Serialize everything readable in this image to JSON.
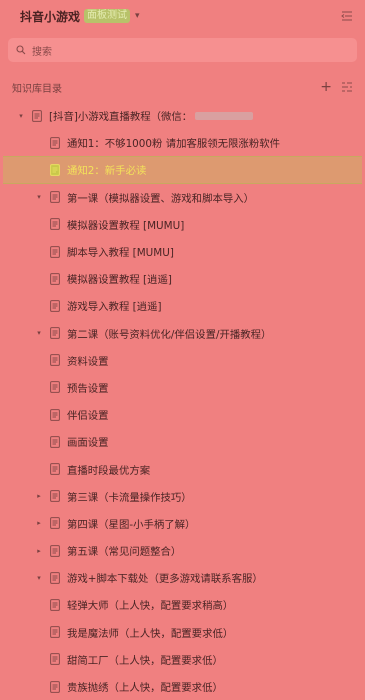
{
  "header": {
    "title": "抖音小游戏",
    "badge": "面板测试",
    "caret": "▾"
  },
  "search": {
    "placeholder": "搜索"
  },
  "section": {
    "title": "知识库目录",
    "add": "+"
  },
  "tree": [
    {
      "label": "[抖音]小游戏直播教程（微信：",
      "level": 0,
      "arrow": "▾",
      "blurred": true
    },
    {
      "label": "通知1：不够1000粉 请加客服领无限涨粉软件",
      "level": 1,
      "arrow": ""
    },
    {
      "label": "通知2：新手必读",
      "level": 1,
      "arrow": "",
      "selected": true
    },
    {
      "label": "第一课（模拟器设置、游戏和脚本导入）",
      "level": 1,
      "arrow": "▾"
    },
    {
      "label": "模拟器设置教程 [MUMU]",
      "level": 2,
      "arrow": ""
    },
    {
      "label": "脚本导入教程 [MUMU]",
      "level": 2,
      "arrow": ""
    },
    {
      "label": "模拟器设置教程 [逍遥]",
      "level": 2,
      "arrow": ""
    },
    {
      "label": "游戏导入教程 [逍遥]",
      "level": 2,
      "arrow": ""
    },
    {
      "label": "第二课（账号资料优化/伴侣设置/开播教程）",
      "level": 1,
      "arrow": "▾"
    },
    {
      "label": "资料设置",
      "level": 2,
      "arrow": ""
    },
    {
      "label": "预告设置",
      "level": 2,
      "arrow": ""
    },
    {
      "label": "伴侣设置",
      "level": 2,
      "arrow": ""
    },
    {
      "label": "画面设置",
      "level": 2,
      "arrow": ""
    },
    {
      "label": "直播时段最优方案",
      "level": 2,
      "arrow": ""
    },
    {
      "label": "第三课（卡流量操作技巧）",
      "level": 1,
      "arrow": "▸"
    },
    {
      "label": "第四课（星图-小手柄了解）",
      "level": 1,
      "arrow": "▸"
    },
    {
      "label": "第五课（常见问题整合）",
      "level": 1,
      "arrow": "▸"
    },
    {
      "label": "游戏+脚本下载处（更多游戏请联系客服）",
      "level": 1,
      "arrow": "▾"
    },
    {
      "label": "轻弹大师（上人快，配置要求稍高）",
      "level": 2,
      "arrow": ""
    },
    {
      "label": "我是魔法师（上人快，配置要求低）",
      "level": 2,
      "arrow": ""
    },
    {
      "label": "甜简工厂（上人快，配置要求低）",
      "level": 2,
      "arrow": ""
    },
    {
      "label": "贵族抛绣（上人快，配置要求低）",
      "level": 2,
      "arrow": ""
    }
  ]
}
